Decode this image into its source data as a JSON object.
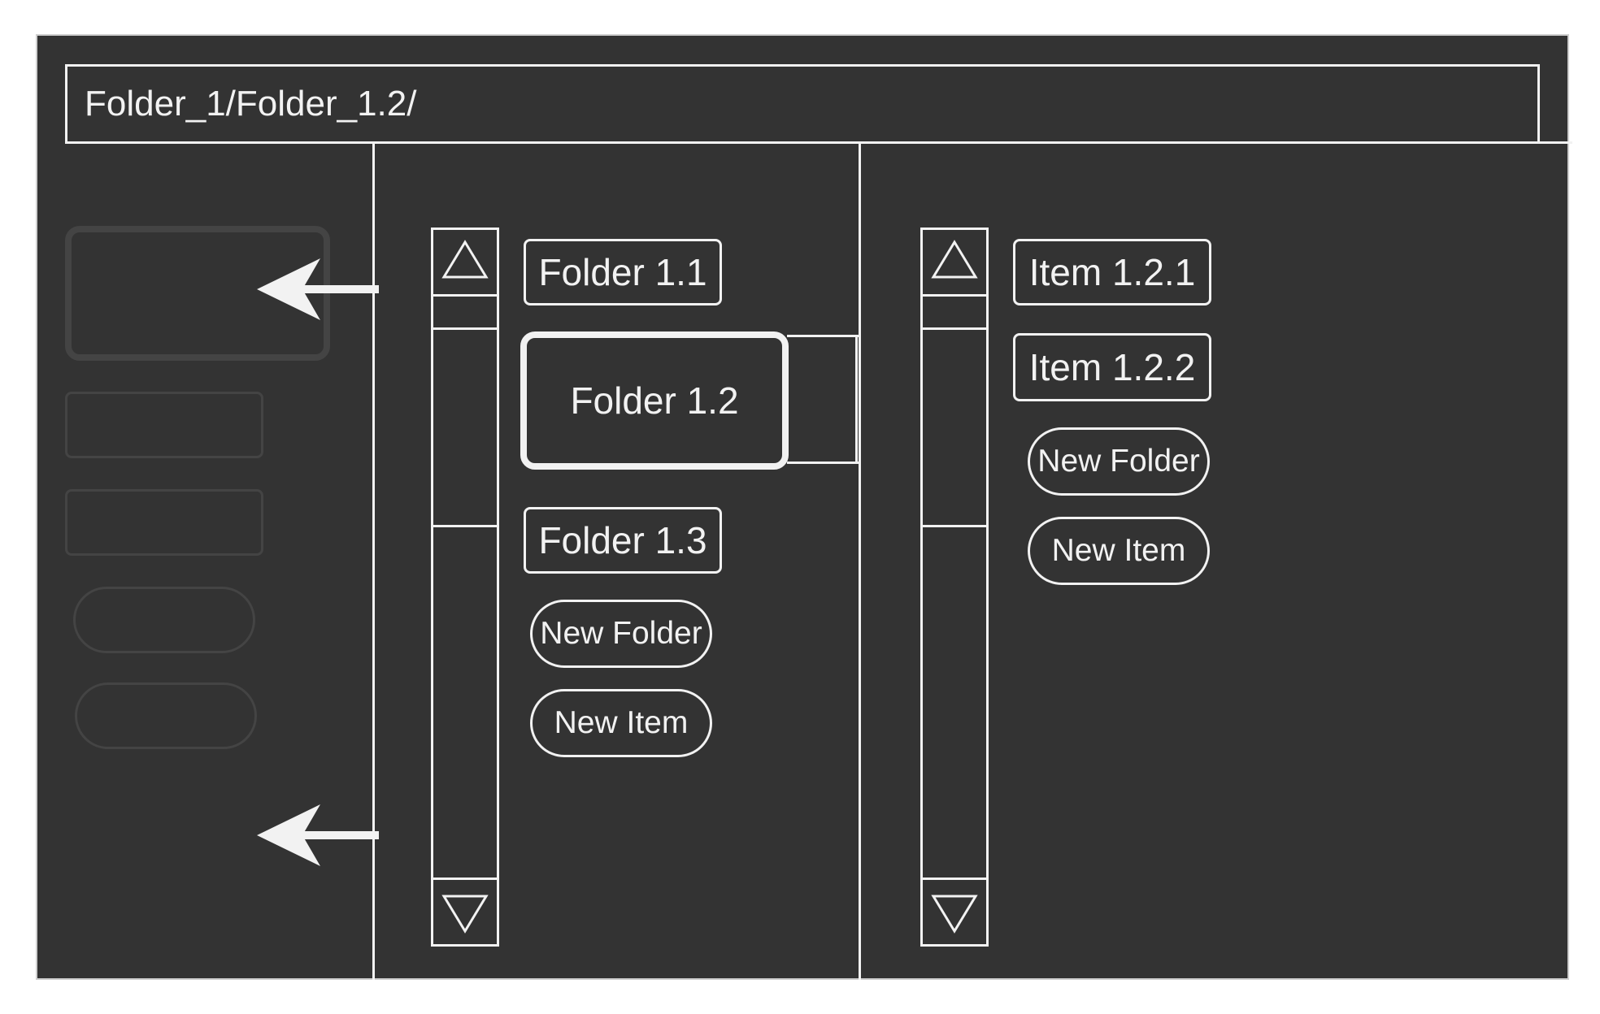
{
  "path_bar": {
    "text": "Folder_1/Folder_1.2/"
  },
  "column_1": {
    "folders": [
      "Folder 1.1",
      "Folder 1.2",
      "Folder 1.3"
    ],
    "selected": "Folder 1.2",
    "actions": [
      "New Folder",
      "New Item"
    ]
  },
  "column_2": {
    "items": [
      "Item 1.2.1",
      "Item 1.2.2"
    ],
    "actions": [
      "New Folder",
      "New Item"
    ]
  },
  "colors": {
    "background": "#333333",
    "foreground": "#f2f2f2",
    "ghost": "#444444"
  },
  "icons": [
    "scroll-up-arrow-icon",
    "scroll-down-arrow-icon",
    "left-arrow-icon"
  ]
}
